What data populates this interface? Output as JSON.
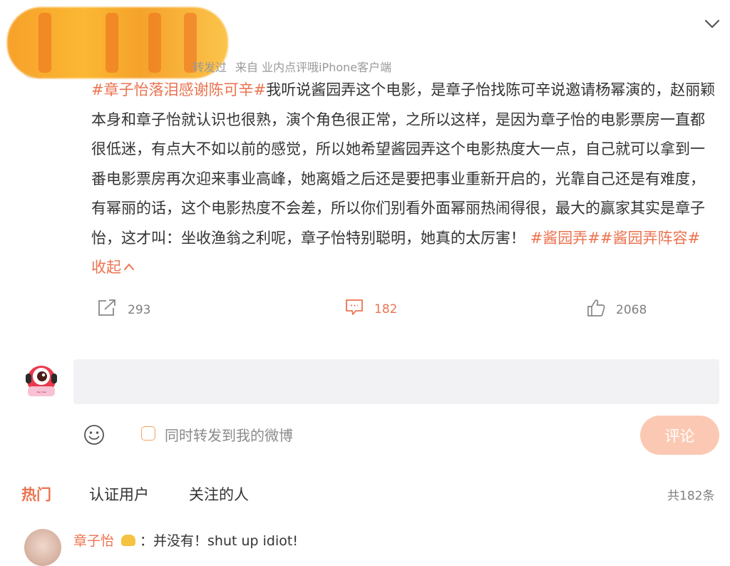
{
  "post": {
    "meta_action": "转发过",
    "meta_source": "来自 业内点评哦iPhone客户端",
    "body": {
      "tag_lead": "#章子怡落泪感谢陈可辛#",
      "text": "我听说酱园弄这个电影，是章子怡找陈可辛说邀请杨幂演的，赵丽颖本身和章子怡就认识也很熟，演个角色很正常，之所以这样，是因为章子怡的电影票房一直都很低迷，有点大不如以前的感觉，所以她希望酱园弄这个电影热度大一点，自己就可以拿到一番电影票房再次迎来事业高峰，她离婚之后还是要把事业重新开启的，光靠自己还是有难度，有幂丽的话，这个电影热度不会差，所以你们别看外面幂丽热闹得很，最大的赢家其实是章子怡，这才叫：坐收渔翁之利呢，章子怡特别聪明，她真的太厉害！",
      "tag_2": "#酱园弄#",
      "tag_3": "#酱园弄阵容#",
      "collapse_label": "收起",
      "collapse_icon": "^"
    },
    "actions": {
      "share_count": "293",
      "comment_count": "182",
      "like_count": "2068"
    }
  },
  "composer": {
    "placeholder": "",
    "repost_label": "同时转发到我的微博",
    "submit_label": "评论"
  },
  "comment_tabs": {
    "tabs": [
      "热门",
      "认证用户",
      "关注的人"
    ],
    "total": "共182条"
  },
  "first_comment": {
    "user": "章子怡",
    "text": "：并没有！shut up idiot!"
  },
  "colors": {
    "accent": "#eb7350",
    "submit_disabled": "#fbc9b3",
    "input_bg": "#f2f2f5"
  },
  "icons": {
    "collapse_chevron": "chevron-down-icon",
    "share": "share-icon",
    "comment": "comment-icon",
    "like": "thumbs-up-icon",
    "emoji": "emoji-icon"
  }
}
